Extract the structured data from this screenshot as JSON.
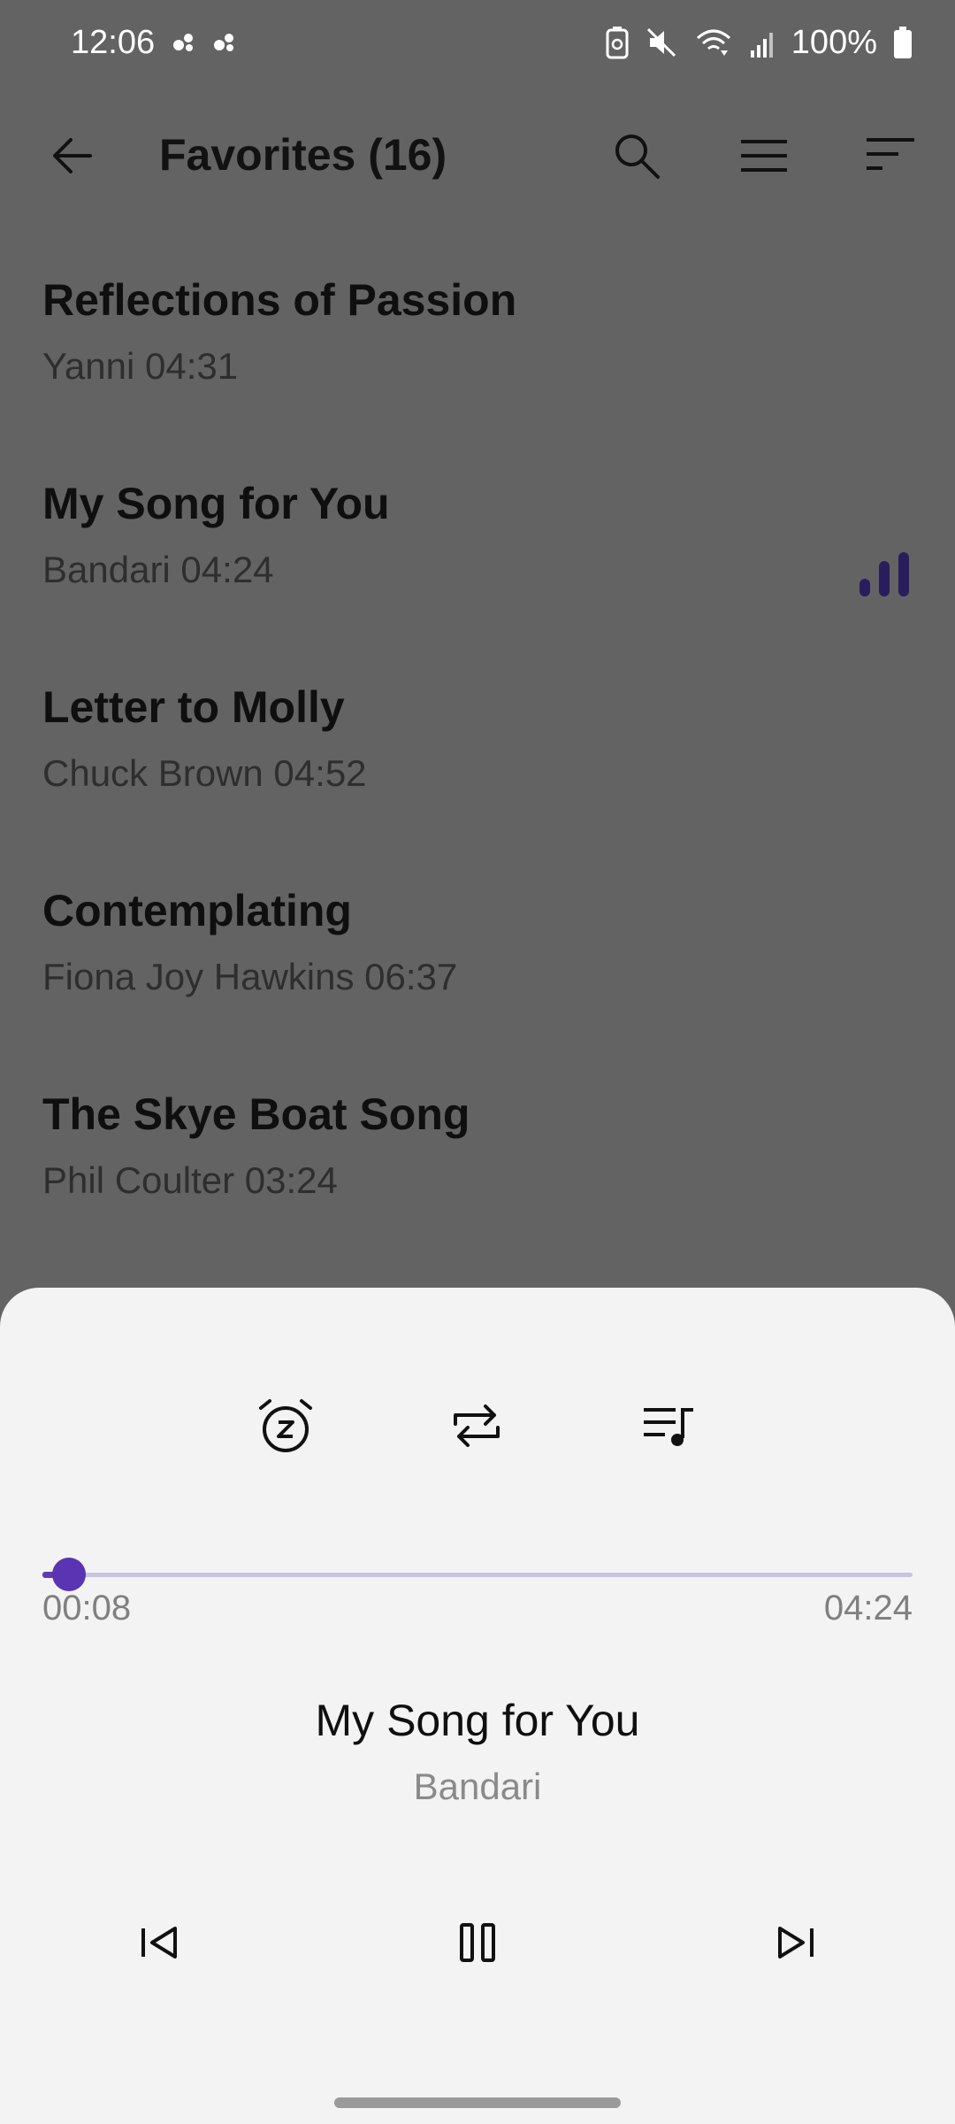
{
  "status_bar": {
    "time": "12:06",
    "battery": "100%",
    "icons": [
      "notification-dot-icon",
      "notification-dot-icon",
      "battery-saver-icon",
      "mute-icon",
      "wifi-icon",
      "signal-icon",
      "battery-icon"
    ]
  },
  "app_bar": {
    "title": "Favorites (16)",
    "icons": [
      "back-arrow-icon",
      "search-icon",
      "menu-icon",
      "sort-icon"
    ]
  },
  "songs": [
    {
      "title": "Reflections of Passion",
      "meta": "Yanni 04:31",
      "playing": false
    },
    {
      "title": "My Song for You",
      "meta": "Bandari 04:24",
      "playing": true
    },
    {
      "title": "Letter to Molly",
      "meta": "Chuck Brown 04:52",
      "playing": false
    },
    {
      "title": "Contemplating",
      "meta": "Fiona Joy Hawkins 06:37",
      "playing": false
    },
    {
      "title": "The Skye Boat Song",
      "meta": "Phil Coulter 03:24",
      "playing": false
    }
  ],
  "player": {
    "actions": [
      "sleep-timer-icon",
      "repeat-icon",
      "queue-icon"
    ],
    "current_time": "00:08",
    "total_time": "04:24",
    "progress": 0.03,
    "title": "My Song for You",
    "artist": "Bandari",
    "controls": [
      "previous-icon",
      "pause-icon",
      "next-icon"
    ]
  },
  "colors": {
    "accent": "#5a34b2",
    "track": "#c8c3e0",
    "scrim": "#636363",
    "sheet": "#f3f3f3",
    "playing_indicator": "#2a1d5e"
  }
}
